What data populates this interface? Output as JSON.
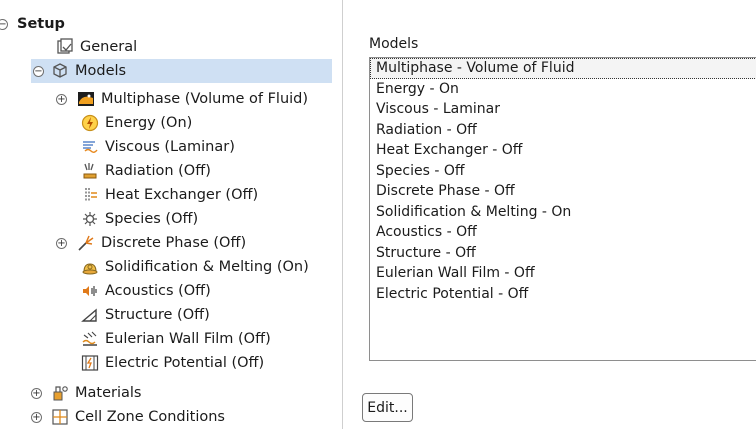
{
  "tree": {
    "setup": "Setup",
    "general": "General",
    "models": "Models",
    "items": [
      "Multiphase (Volume of Fluid)",
      "Energy (On)",
      "Viscous (Laminar)",
      "Radiation (Off)",
      "Heat Exchanger (Off)",
      "Species (Off)",
      "Discrete Phase (Off)",
      "Solidification & Melting (On)",
      "Acoustics (Off)",
      "Structure (Off)",
      "Eulerian Wall Film (Off)",
      "Electric Potential (Off)"
    ],
    "materials": "Materials",
    "cell_zone": "Cell Zone Conditions"
  },
  "panel": {
    "title": "Models",
    "list": [
      "Multiphase - Volume of Fluid",
      "Energy - On",
      "Viscous - Laminar",
      "Radiation - Off",
      "Heat Exchanger - Off",
      "Species - Off",
      "Discrete Phase - Off",
      "Solidification & Melting - On",
      "Acoustics - Off",
      "Structure - Off",
      "Eulerian Wall Film - Off",
      "Electric Potential - Off"
    ],
    "edit_label": "Edit..."
  },
  "icons": {
    "general": "general-icon",
    "models": "models-icon",
    "multiphase": "multiphase-icon",
    "energy": "energy-icon",
    "viscous": "viscous-icon",
    "radiation": "radiation-icon",
    "heat_exchanger": "heat-exchanger-icon",
    "species": "species-icon",
    "discrete_phase": "discrete-phase-icon",
    "solidification": "solidification-icon",
    "acoustics": "acoustics-icon",
    "structure": "structure-icon",
    "eulerian_wall_film": "eulerian-wall-film-icon",
    "electric_potential": "electric-potential-icon",
    "materials": "materials-icon",
    "cell_zone": "cell-zone-icon"
  },
  "colors": {
    "selection": "#cfe0f3"
  }
}
